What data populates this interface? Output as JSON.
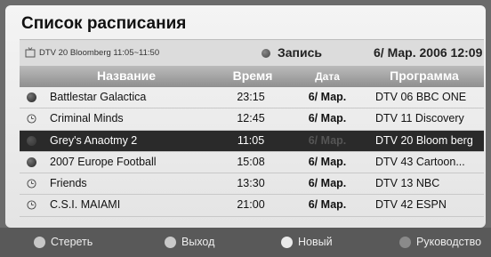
{
  "title": "Список расписания",
  "info": {
    "channel": "DTV 20 Bloomberg 11:05~11:50",
    "record_label": "Запись",
    "datetime": "6/ Мар.  2006 12:09"
  },
  "columns": [
    "Название",
    "Время",
    "Дата",
    "Программа"
  ],
  "rows": [
    {
      "icon": "record-dot-icon",
      "name": "Battlestar Galactica",
      "time": "23:15",
      "date": "6/ Мар.",
      "program": "DTV 06 BBC ONE",
      "selected": false
    },
    {
      "icon": "clock-icon",
      "name": "Criminal Minds",
      "time": "12:45",
      "date": "6/ Мар.",
      "program": "DTV 11 Discovery",
      "selected": false
    },
    {
      "icon": "record-dot-icon",
      "name": "Grey's Anaotmy 2",
      "time": "11:05",
      "date": "6/ Мар.",
      "program": "DTV 20 Bloom berg",
      "selected": true
    },
    {
      "icon": "record-dot-icon",
      "name": "2007 Europe Football",
      "time": "15:08",
      "date": "6/ Мар.",
      "program": "DTV 43 Cartoon...",
      "selected": false
    },
    {
      "icon": "clock-icon",
      "name": "Friends",
      "time": "13:30",
      "date": "6/ Мар.",
      "program": "DTV 13 NBC",
      "selected": false
    },
    {
      "icon": "clock-icon",
      "name": "C.S.I. MAIAMI",
      "time": "21:00",
      "date": "6/ Мар.",
      "program": "DTV 42 ESPN",
      "selected": false
    }
  ],
  "footer": {
    "delete": "Стереть",
    "exit": "Выход",
    "new": "Новый",
    "guide": "Руководство"
  },
  "colors": {
    "delete": "#c7c7c7",
    "exit": "#c9c9c9",
    "new": "#eaeaea",
    "guide": "#8a8a8a"
  }
}
